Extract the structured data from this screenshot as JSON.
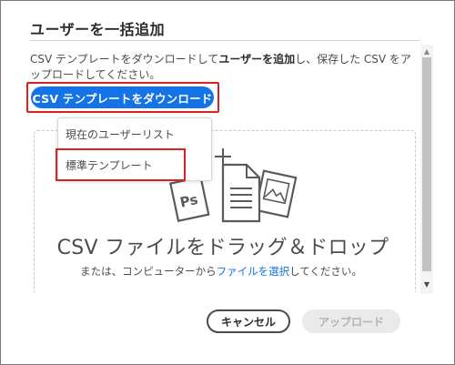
{
  "dialog": {
    "title": "ユーザーを一括追加",
    "description": {
      "part1": "CSV テンプレートをダウンロードして",
      "bold": "ユーザーを追加",
      "part2": "し、保存した CSV をアップロードしてください。"
    },
    "download_button_label": "CSV テンプレートをダウンロード",
    "menu": {
      "items": [
        {
          "label": "現在のユーザーリスト"
        },
        {
          "label": "標準テンプレート"
        }
      ]
    },
    "drop_zone": {
      "title": "CSV ファイルをドラッグ＆ドロップ",
      "subtitle_prefix": "または、コンピューターから",
      "subtitle_link": "ファイルを選択",
      "subtitle_suffix": "してください。"
    },
    "buttons": {
      "cancel": "キャンセル",
      "upload": "アップロード"
    },
    "icons": {
      "illustration_plus": "plus-icon",
      "illustration_ps": "photoshop-file-icon",
      "illustration_doc": "document-icon",
      "illustration_image": "image-file-icon"
    },
    "colors": {
      "accent": "#1473e6",
      "highlight_outline": "#e02020"
    }
  }
}
